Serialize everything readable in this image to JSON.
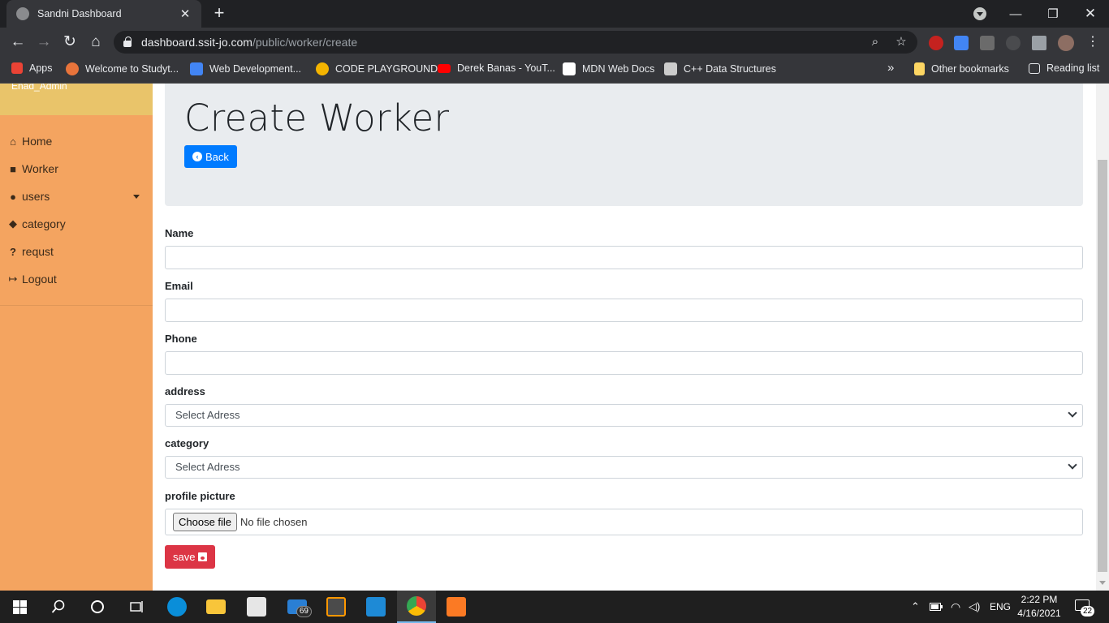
{
  "browser": {
    "tab_title": "Sandni Dashboard",
    "new_tab_symbol": "+",
    "url_host": "dashboard.ssit-jo.com",
    "url_path": "/public/worker/create",
    "bookmarks": [
      {
        "label": "Apps",
        "color": "#ea4335"
      },
      {
        "label": "Welcome to Studyt...",
        "color": "#e8743b"
      },
      {
        "label": "Web Development...",
        "color": "#4285f4"
      },
      {
        "label": "CODE PLAYGROUND",
        "color": "#f4b400"
      },
      {
        "label": "Derek Banas - YouT...",
        "color": "#ff0000"
      },
      {
        "label": "MDN Web Docs",
        "color": "#ffffff"
      },
      {
        "label": "C++ Data Structures",
        "color": "#cccccc"
      }
    ],
    "more_bookmarks": "»",
    "other_bookmarks": "Other bookmarks",
    "reading_list": "Reading list"
  },
  "sidebar": {
    "brand": "Enad_Admin",
    "items": [
      {
        "label": "Home",
        "icon": "home-icon"
      },
      {
        "label": "Worker",
        "icon": "briefcase-icon"
      },
      {
        "label": "users",
        "icon": "users-icon"
      },
      {
        "label": "category",
        "icon": "tags-icon"
      },
      {
        "label": "requst",
        "icon": "question-icon"
      },
      {
        "label": "Logout",
        "icon": "sign-out-icon"
      }
    ]
  },
  "header": {
    "title": "Create Worker",
    "back_label": "Back"
  },
  "form": {
    "name_label": "Name",
    "name_value": "",
    "email_label": "Email",
    "email_value": "",
    "phone_label": "Phone",
    "phone_value": "",
    "address_label": "address",
    "address_selected": "Select Adress",
    "category_label": "category",
    "category_selected": "Select Adress",
    "picture_label": "profile picture",
    "file_button": "Choose file",
    "file_status": "No file chosen",
    "save_label": "save"
  },
  "taskbar": {
    "mail_badge": "69",
    "lang": "ENG",
    "time": "2:22 PM",
    "date": "4/16/2021",
    "notifications": "22"
  },
  "colors": {
    "sidebar": "#f4a460",
    "sidebar_top": "#e9c46a",
    "primary": "#007bff",
    "danger": "#dc3545"
  }
}
